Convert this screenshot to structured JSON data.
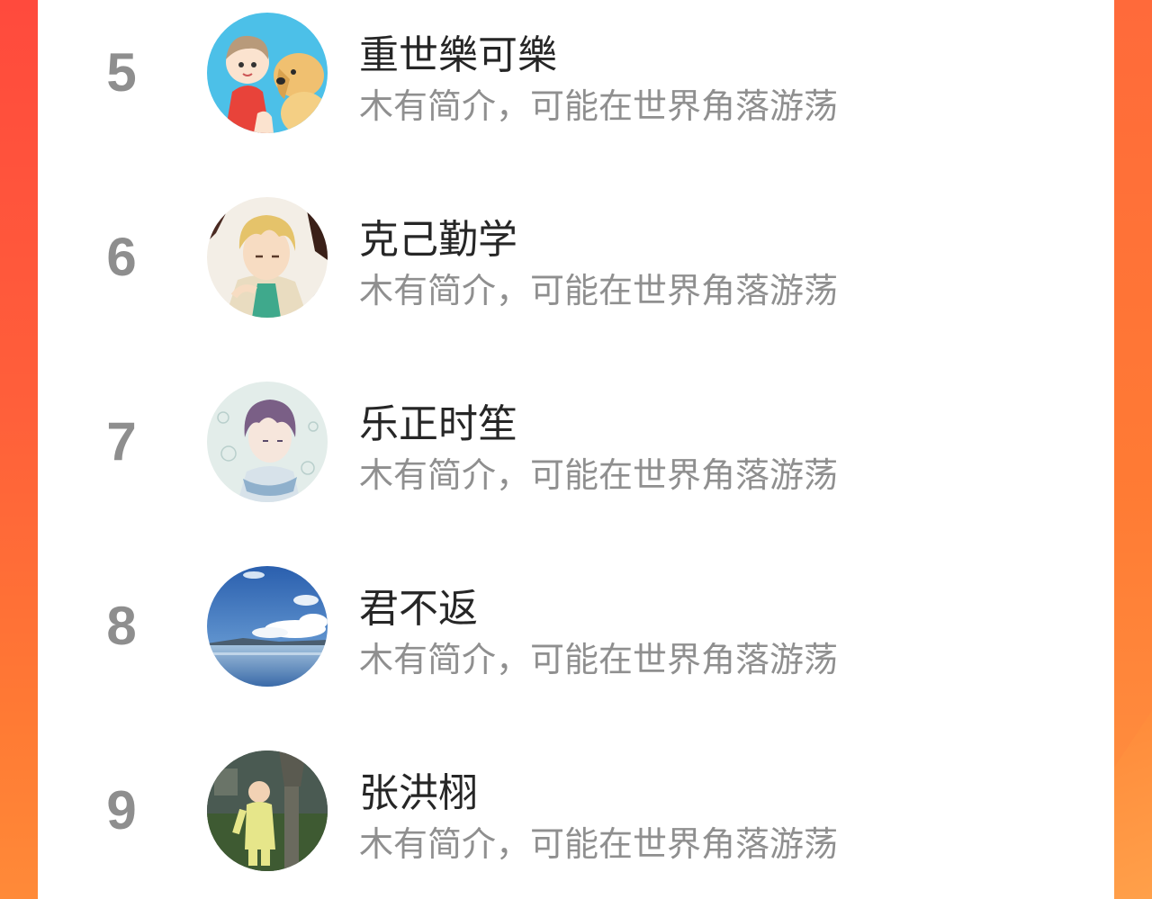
{
  "ranking": {
    "items": [
      {
        "rank": "5",
        "name": "重世樂可樂",
        "bio": "木有简介，可能在世界角落游荡",
        "avatar": "anime-boy-and-dog-avatar"
      },
      {
        "rank": "6",
        "name": "克己勤学",
        "bio": "木有简介，可能在世界角落游荡",
        "avatar": "blond-anime-character-avatar"
      },
      {
        "rank": "7",
        "name": "乐正时笙",
        "bio": "木有简介，可能在世界角落游荡",
        "avatar": "purple-hair-anime-boy-avatar"
      },
      {
        "rank": "8",
        "name": "君不返",
        "bio": "木有简介，可能在世界角落游荡",
        "avatar": "sky-and-lake-avatar"
      },
      {
        "rank": "9",
        "name": "张洪栩",
        "bio": "木有简介，可能在世界角落游荡",
        "avatar": "child-under-tree-avatar"
      }
    ]
  },
  "colors": {
    "background_gradient": [
      "#ff4a3d",
      "#ff8a38"
    ],
    "rank_color": "#8e8e8e",
    "name_color": "#262626",
    "bio_color": "#8f8f8f"
  }
}
